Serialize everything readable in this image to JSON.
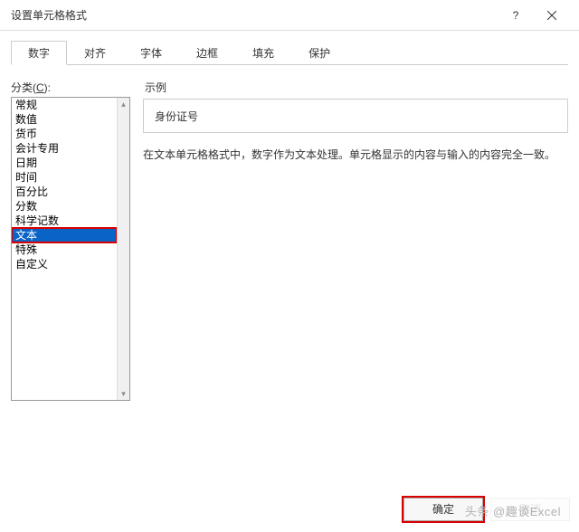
{
  "window": {
    "title": "设置单元格格式"
  },
  "tabs": [
    {
      "label": "数字",
      "active": true
    },
    {
      "label": "对齐",
      "active": false
    },
    {
      "label": "字体",
      "active": false
    },
    {
      "label": "边框",
      "active": false
    },
    {
      "label": "填充",
      "active": false
    },
    {
      "label": "保护",
      "active": false
    }
  ],
  "category": {
    "label_prefix": "分类(",
    "label_hotkey": "C",
    "label_suffix": "):",
    "items": [
      "常规",
      "数值",
      "货币",
      "会计专用",
      "日期",
      "时间",
      "百分比",
      "分数",
      "科学记数",
      "文本",
      "特殊",
      "自定义"
    ],
    "selected_index": 9
  },
  "sample": {
    "label": "示例",
    "value": "身份证号"
  },
  "description": "在文本单元格格式中，数字作为文本处理。单元格显示的内容与输入的内容完全一致。",
  "buttons": {
    "ok": "确定",
    "cancel": "取消"
  },
  "watermark": "头条 @趣谈Excel"
}
